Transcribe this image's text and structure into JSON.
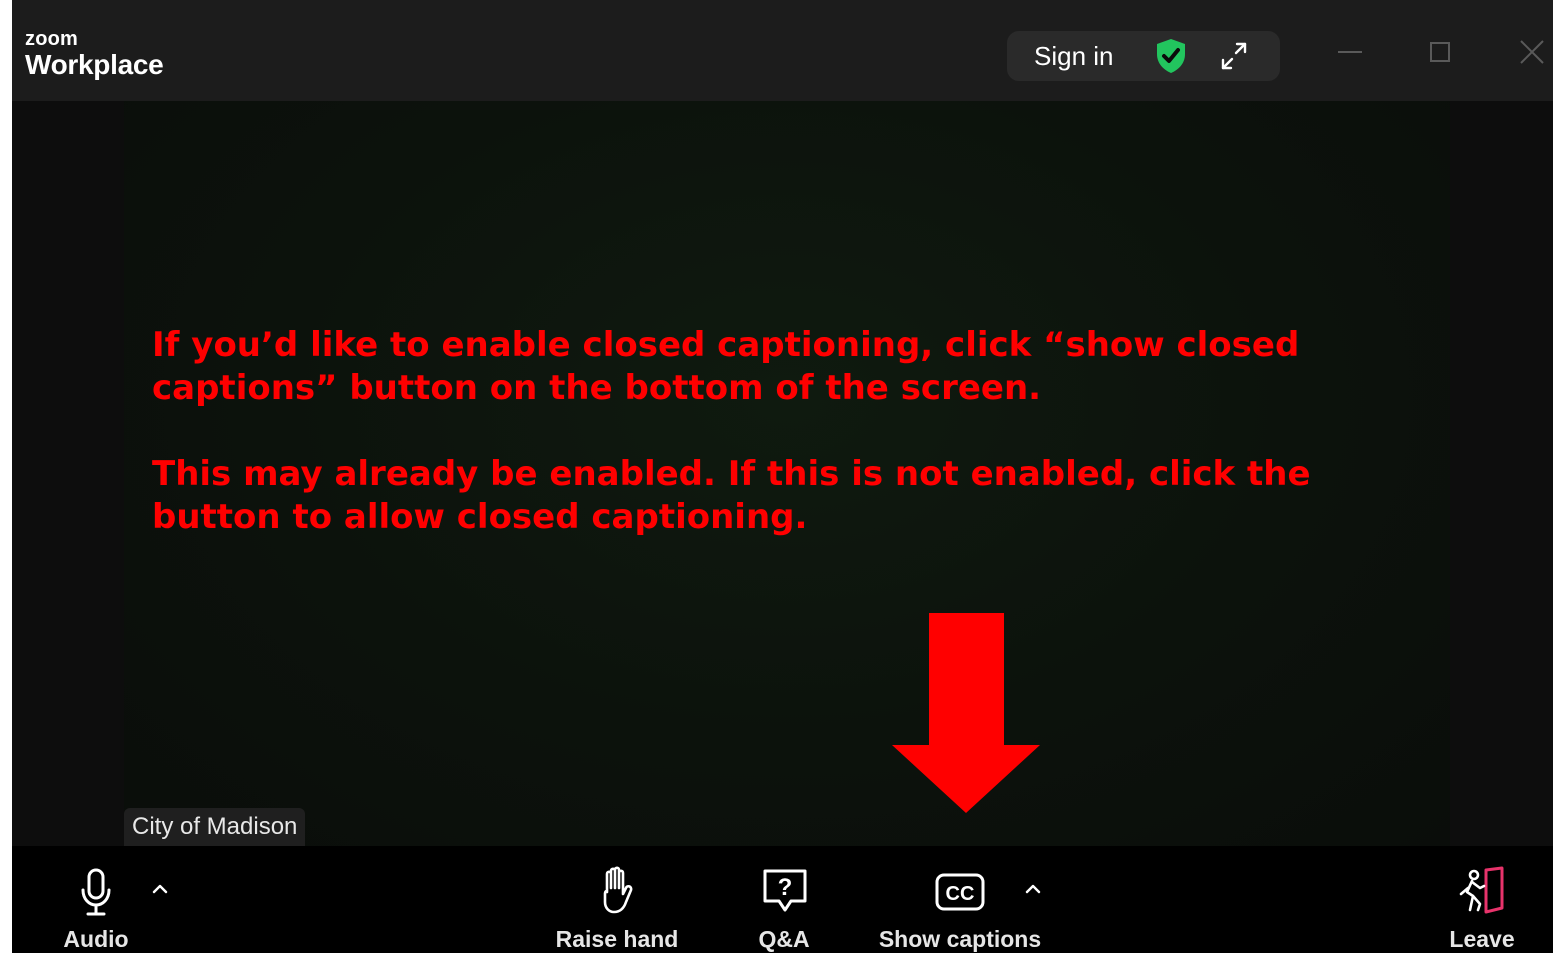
{
  "titlebar": {
    "brand_small": "zoom",
    "brand_large": "Workplace",
    "signin_label": "Sign in",
    "security_icon_color": "#22c55e"
  },
  "video": {
    "notice_line_1": "If you’d like to enable closed captioning, click “show closed captions” button on the bottom of the screen.",
    "notice_line_2": "This may already be enabled. If this is not enabled, click the button to allow closed captioning.",
    "notice_color": "#ff0000",
    "participant_name": "City of Madison"
  },
  "toolbar": {
    "audio_label": "Audio",
    "raise_hand_label": "Raise hand",
    "qa_label": "Q&A",
    "captions_label": "Show captions",
    "leave_label": "Leave",
    "leave_accent": "#e8336b"
  },
  "icons": [
    "shield-check-icon",
    "expand-icon",
    "minimize-icon",
    "maximize-icon",
    "close-icon",
    "microphone-icon",
    "chevron-up-icon",
    "hand-icon",
    "question-bubble-icon",
    "cc-icon",
    "leave-door-icon",
    "arrow-down-icon"
  ]
}
